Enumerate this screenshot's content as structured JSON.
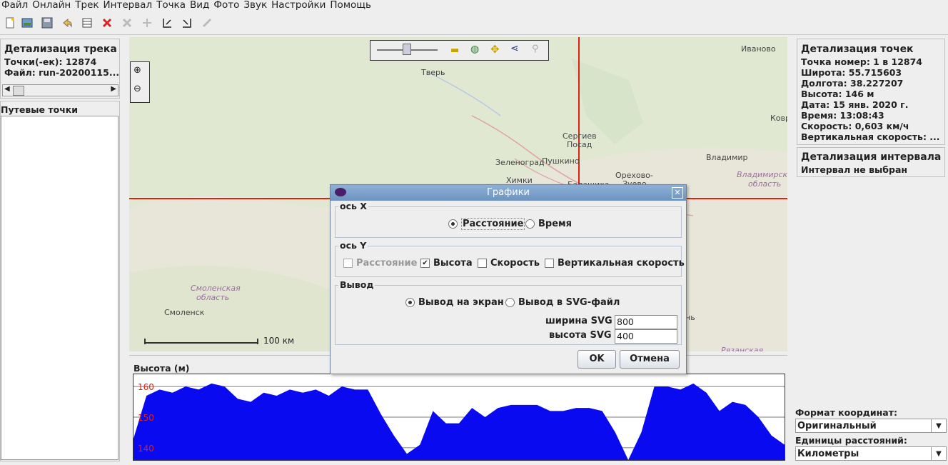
{
  "menu": [
    "Файл",
    "Онлайн",
    "Трек",
    "Интервал",
    "Точка",
    "Вид",
    "Фото",
    "Звук",
    "Настройки",
    "Помощь"
  ],
  "toolbar_icons": [
    "new-file-icon",
    "open-photo-icon",
    "save-icon",
    "undo-icon",
    "table-icon",
    "delete-icon",
    "cut-icon",
    "merge-icon",
    "set-start-icon",
    "set-end-icon",
    "compress-icon"
  ],
  "track": {
    "title": "Детализация трека",
    "points": "Точки(-ек): 12874",
    "file": "Файл: run-20200115..."
  },
  "waypoints": {
    "title": "Путевые точки"
  },
  "point": {
    "title": "Детализация точек",
    "lines": [
      "Точка номер: 1 в 12874",
      "Широта: 55.715603",
      "Долгота: 38.227207",
      "Высота: 146 м",
      "Дата: 15 янв. 2020 г.",
      "Время: 13:08:43",
      "Скорость: 0,603 км/ч",
      "Вертикальная скорость: ..."
    ]
  },
  "interval": {
    "title": "Детализация интервала",
    "text": "Интервал не выбран"
  },
  "coord_format": {
    "label": "Формат координат:",
    "value": "Оригинальный"
  },
  "distance_units": {
    "label": "Единицы расстояний:",
    "value": "Километры"
  },
  "map": {
    "labels": [
      "Тверь",
      "Иваново",
      "Сергиев",
      "Посад",
      "Зеленоград",
      "Пушкино",
      "Химки",
      "Балашиха",
      "Орехово-",
      "Зуево",
      "Владимир",
      "Ковр",
      "Смоленск",
      "нь"
    ],
    "region_labels": [
      "Владимирская",
      "область",
      "Смоленская",
      "область",
      "Рязанская"
    ],
    "scale": "100 км"
  },
  "chart": {
    "title": "Высота (м)",
    "ticks": [
      "160",
      "150",
      "140"
    ]
  },
  "chart_data": {
    "type": "area",
    "title": "Высота (м)",
    "ylim": [
      136,
      164
    ],
    "series": [
      {
        "values": [
          143,
          157,
          159,
          158,
          160,
          159,
          161,
          160,
          156,
          155,
          158,
          157,
          159,
          158,
          159,
          157,
          160,
          159,
          159,
          151,
          144,
          138,
          141,
          152,
          148,
          148,
          153,
          150,
          153,
          154,
          154,
          154,
          152,
          152,
          153,
          153,
          152,
          145,
          136,
          145,
          160,
          160,
          159,
          161,
          158,
          152,
          155,
          154,
          150,
          144,
          141
        ]
      }
    ]
  },
  "dialog": {
    "title": "Графики",
    "x_axis": {
      "label": "ось X",
      "distance": "Расстояние",
      "time": "Время"
    },
    "y_axis": {
      "label": "ось Y",
      "distance": "Расстояние",
      "altitude": "Высота",
      "speed": "Скорость",
      "vspeed": "Вертикальная скорость"
    },
    "output": {
      "label": "Вывод",
      "screen": "Вывод на экран",
      "svg": "Вывод в SVG-файл",
      "svg_width_label": "ширина SVG",
      "svg_width": "800",
      "svg_height_label": "высота SVG",
      "svg_height": "400"
    },
    "ok": "OK",
    "cancel": "Отмена"
  }
}
